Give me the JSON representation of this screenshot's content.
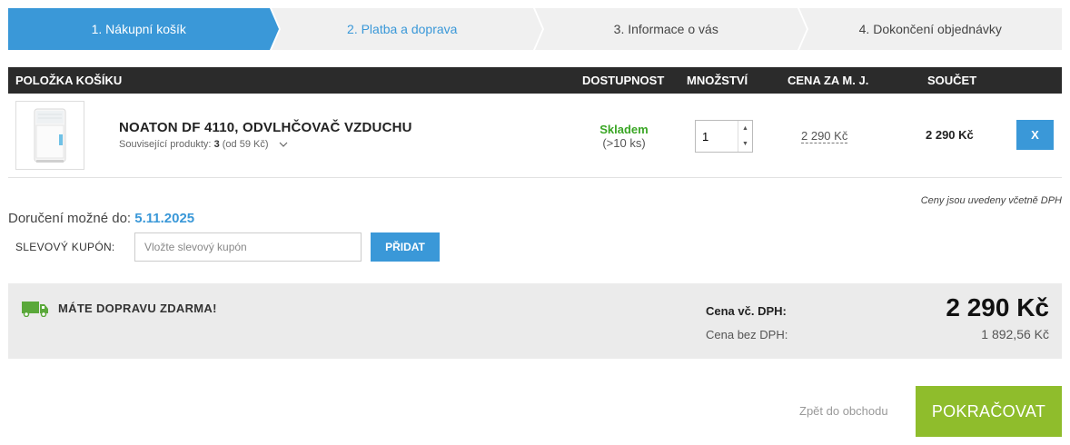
{
  "steps": [
    {
      "label": "1. Nákupní košík"
    },
    {
      "label": "2. Platba a doprava"
    },
    {
      "label": "3. Informace o vás"
    },
    {
      "label": "4. Dokončení objednávky"
    }
  ],
  "table": {
    "headers": {
      "item": "POLOŽKA KOŠÍKU",
      "availability": "DOSTUPNOST",
      "quantity": "MNOŽSTVÍ",
      "unit_price": "CENA ZA M. J.",
      "total": "SOUČET"
    }
  },
  "item": {
    "name": "NOATON DF 4110, ODVLHČOVAČ VZDUCHU",
    "related_prefix": "Související produkty:",
    "related_count": "3",
    "related_from": "(od 59 Kč)",
    "stock_status": "Skladem",
    "stock_qty": "(>10 ks)",
    "quantity": "1",
    "unit_price": "2 290 Kč",
    "total": "2 290 Kč",
    "remove_label": "X"
  },
  "tax_note": "Ceny jsou uvedeny včetně DPH",
  "delivery": {
    "label": "Doručení možné do:",
    "date": "5.11.2025"
  },
  "coupon": {
    "label": "SLEVOVÝ KUPÓN:",
    "placeholder": "Vložte slevový kupón",
    "button": "PŘIDAT"
  },
  "summary": {
    "free_shipping": "MÁTE DOPRAVU ZDARMA!",
    "price_vat_label": "Cena vč. DPH:",
    "price_vat": "2 290 Kč",
    "price_novat_label": "Cena bez DPH:",
    "price_novat": "1 892,56 Kč"
  },
  "actions": {
    "back": "Zpět do obchodu",
    "continue": "POKRAČOVAT"
  },
  "colors": {
    "accent": "#3a98d8",
    "stock": "#3aa625",
    "continue": "#8fbd2c",
    "header_bg": "#2b2b2b"
  }
}
